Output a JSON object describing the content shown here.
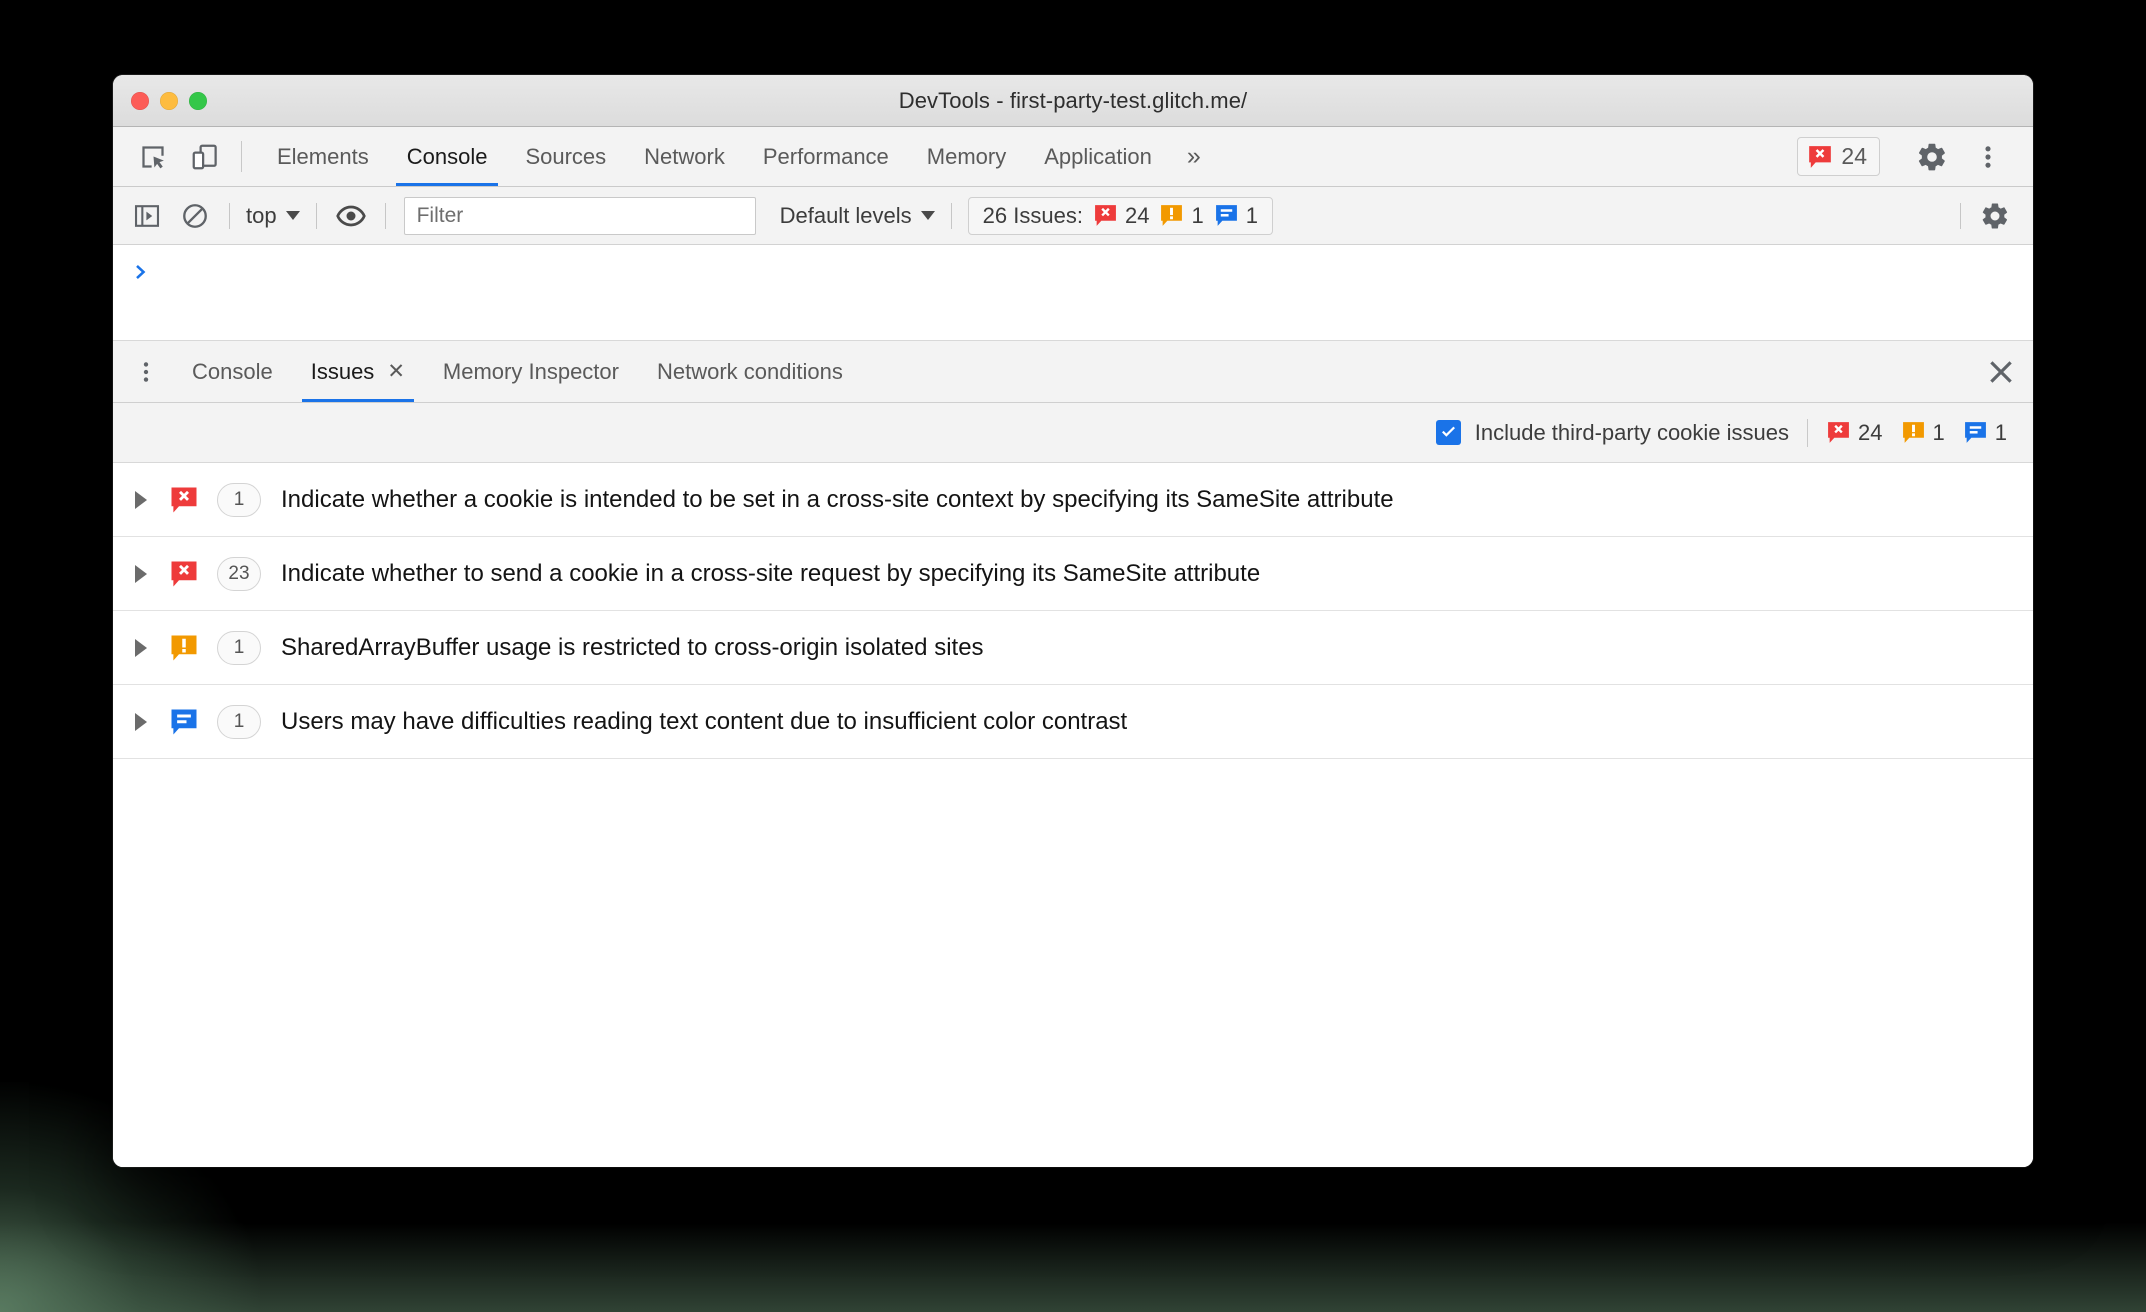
{
  "window": {
    "title": "DevTools - first-party-test.glitch.me/",
    "traffic_lights": [
      "close",
      "minimize",
      "maximize"
    ]
  },
  "main_tabbar": {
    "left_icons": [
      {
        "name": "inspect-element-icon",
        "label": "Inspect element"
      },
      {
        "name": "device-toolbar-icon",
        "label": "Toggle device toolbar"
      }
    ],
    "tabs": [
      {
        "label": "Elements",
        "active": false
      },
      {
        "label": "Console",
        "active": true
      },
      {
        "label": "Sources",
        "active": false
      },
      {
        "label": "Network",
        "active": false
      },
      {
        "label": "Performance",
        "active": false
      },
      {
        "label": "Memory",
        "active": false
      },
      {
        "label": "Application",
        "active": false
      }
    ],
    "overflow_label": "»",
    "error_badge": {
      "icon": "error-bubble-icon",
      "count": "24"
    },
    "settings_icon": "gear-icon",
    "more_icon": "three-dots-vertical-icon"
  },
  "console_toolbar": {
    "sidebar_toggle_icon": "console-sidebar-icon",
    "clear_console_icon": "clear-console-icon",
    "context_selector": {
      "value": "top"
    },
    "live_expression_icon": "eye-icon",
    "filter": {
      "placeholder": "Filter",
      "value": ""
    },
    "levels_selector": {
      "value": "Default levels"
    },
    "issues_summary": {
      "label": "26 Issues:",
      "errors": "24",
      "warnings": "1",
      "info": "1"
    },
    "settings_icon": "gear-icon"
  },
  "console_output": {
    "prompt": ">",
    "entries": []
  },
  "drawer": {
    "menu_icon": "three-dots-vertical-icon",
    "tabs": [
      {
        "label": "Console",
        "active": false,
        "closable": false
      },
      {
        "label": "Issues",
        "active": true,
        "closable": true,
        "close_label": "✕"
      },
      {
        "label": "Memory Inspector",
        "active": false,
        "closable": false
      },
      {
        "label": "Network conditions",
        "active": false,
        "closable": false
      }
    ],
    "close_icon": "close-icon"
  },
  "issues_panel": {
    "filter_bar": {
      "third_party_checkbox": {
        "label": "Include third-party cookie issues",
        "checked": true
      },
      "counts": {
        "errors": "24",
        "warnings": "1",
        "info": "1"
      }
    },
    "rows": [
      {
        "kind": "error",
        "count": "1",
        "text": "Indicate whether a cookie is intended to be set in a cross-site context by specifying its SameSite attribute",
        "expanded": false
      },
      {
        "kind": "error",
        "count": "23",
        "text": "Indicate whether to send a cookie in a cross-site request by specifying its SameSite attribute",
        "expanded": false
      },
      {
        "kind": "warning",
        "count": "1",
        "text": "SharedArrayBuffer usage is restricted to cross-origin isolated sites",
        "expanded": false
      },
      {
        "kind": "info",
        "count": "1",
        "text": "Users may have difficulties reading text content due to insufficient color contrast",
        "expanded": false
      }
    ]
  },
  "colors": {
    "accent_blue": "#1a73e8",
    "error_red": "#ee3b3b",
    "warning_orange": "#f29900",
    "info_blue": "#1a73e8",
    "titlebar_bg": "#e0e0e0",
    "toolbar_bg": "#f3f3f3",
    "panel_bg": "#ffffff"
  }
}
